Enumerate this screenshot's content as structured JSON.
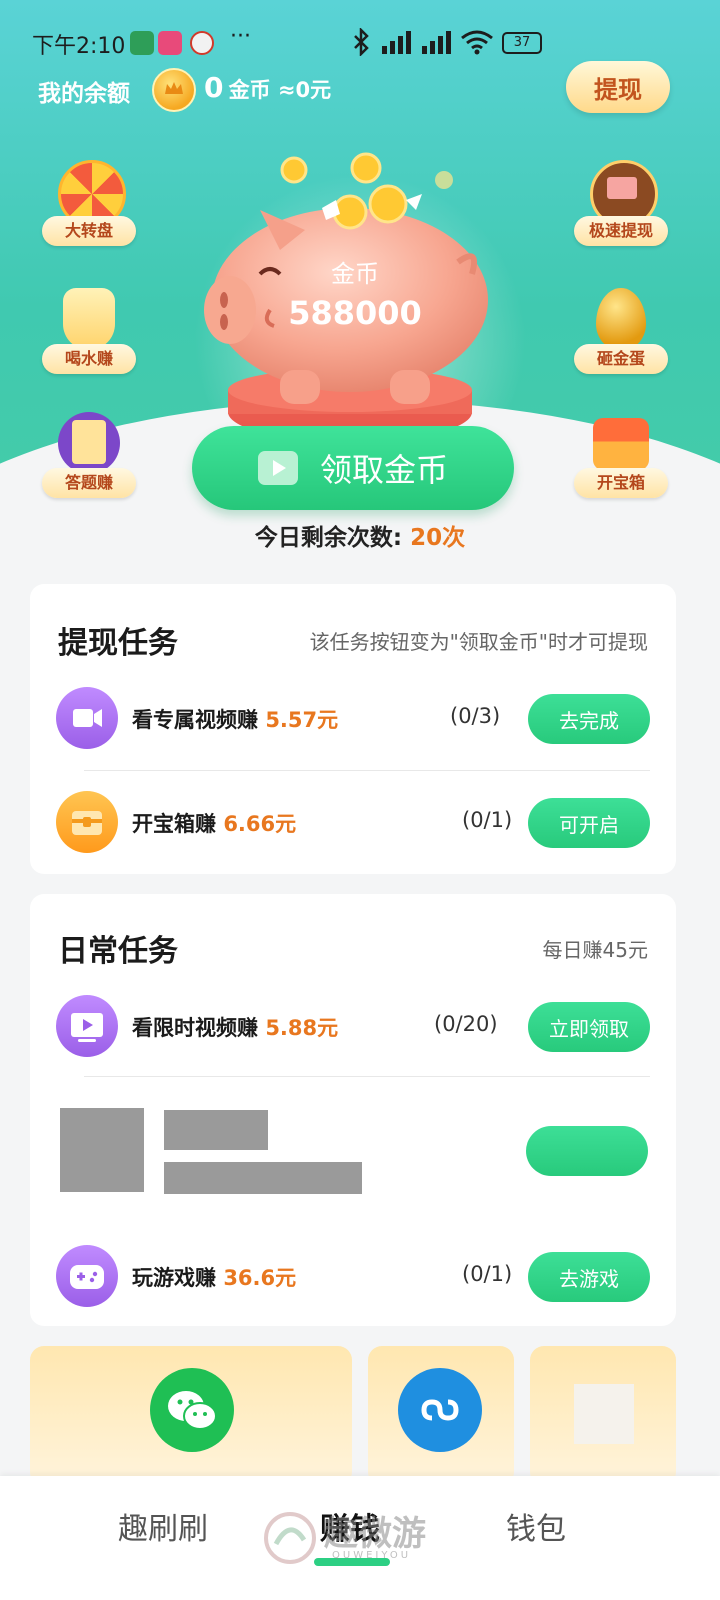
{
  "status_bar": {
    "time": "下午2:10",
    "more": "···",
    "battery": "37"
  },
  "header": {
    "balance_label": "我的余额",
    "balance_value": "0",
    "balance_unit": "金币 ≈0元",
    "withdraw_label": "提现"
  },
  "side_entries": {
    "left": [
      {
        "label": "大转盘",
        "icon": "prize-wheel-icon"
      },
      {
        "label": "喝水赚",
        "icon": "water-cup-icon"
      },
      {
        "label": "答题赚",
        "icon": "quiz-icon"
      }
    ],
    "right": [
      {
        "label": "极速提现",
        "icon": "wallet-icon"
      },
      {
        "label": "砸金蛋",
        "icon": "golden-egg-icon"
      },
      {
        "label": "开宝箱",
        "icon": "treasure-chest-icon"
      }
    ]
  },
  "piggy": {
    "coins_label": "金币",
    "coins_value": "588000"
  },
  "claim": {
    "label": "领取金币",
    "remaining_label": "今日剩余次数:",
    "remaining_count": "20次"
  },
  "withdraw_tasks": {
    "title": "提现任务",
    "note": "该任务按钮变为\"领取金币\"时才可提现",
    "items": [
      {
        "name": "看专属视频赚",
        "reward": "5.57元",
        "progress": "(0/3)",
        "button": "去完成",
        "icon": "video-camera-icon",
        "color": "#a56cf0"
      },
      {
        "name": "开宝箱赚",
        "reward": "6.66元",
        "progress": "(0/1)",
        "button": "可开启",
        "icon": "treasure-box-icon",
        "color": "#ffad2f"
      }
    ]
  },
  "daily_tasks": {
    "title": "日常任务",
    "note": "每日赚45元",
    "items": [
      {
        "name": "看限时视频赚",
        "reward": "5.88元",
        "progress": "(0/20)",
        "button": "立即领取",
        "icon": "play-screen-icon",
        "color": "#a56cf0"
      },
      {
        "name": "玩游戏赚",
        "reward": "36.6元",
        "progress": "(0/1)",
        "button": "去游戏",
        "icon": "game-controller-icon",
        "color": "#a56cf0"
      }
    ]
  },
  "bottom_nav": {
    "items": [
      "趣刷刷",
      "赚钱",
      "钱包"
    ],
    "active": "赚钱"
  },
  "watermark": {
    "text": "趣微游",
    "sub": "QUWEIYOU"
  },
  "colors": {
    "accent_green": "#2ccf83",
    "reward_orange": "#e8771f",
    "header_teal": "#4fcfc4"
  }
}
